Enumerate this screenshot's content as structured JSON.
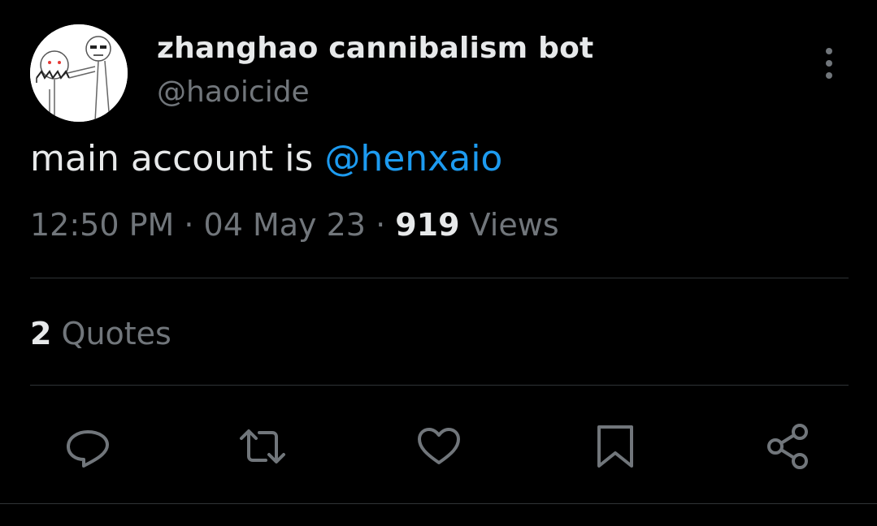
{
  "tweet": {
    "display_name": "zhanghao cannibalism bot",
    "handle": "@haoicide",
    "text_prefix": "main account is ",
    "mention": "@henxaio",
    "time": "12:50 PM",
    "separator": " · ",
    "date": "04 May 23",
    "views_count": "919",
    "views_label": " Views",
    "quotes_count": "2",
    "quotes_label": " Quotes"
  },
  "icons": {
    "more": "more-vertical-icon",
    "reply": "reply-icon",
    "retweet": "retweet-icon",
    "like": "heart-icon",
    "bookmark": "bookmark-icon",
    "share": "share-icon"
  },
  "colors": {
    "background": "#000000",
    "primary_text": "#e7e9ea",
    "secondary_text": "#71767b",
    "link": "#1d9bf0",
    "divider": "#2f3336"
  }
}
